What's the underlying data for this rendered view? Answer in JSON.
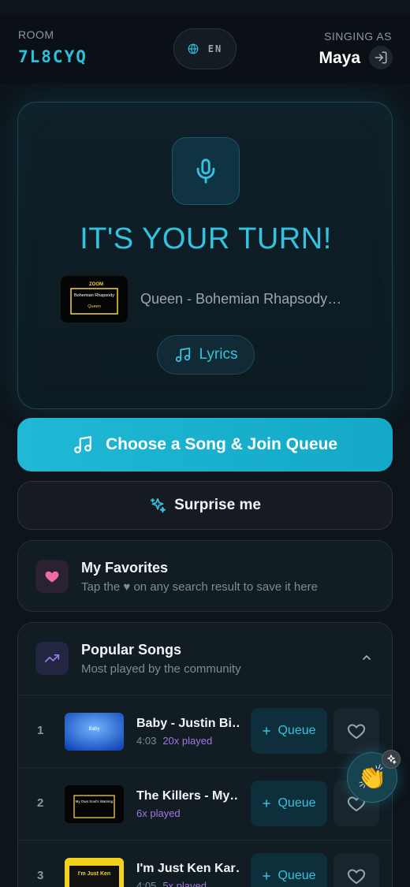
{
  "header": {
    "room_label": "ROOM",
    "room_code": "7L8CYQ",
    "language_code": "EN",
    "singing_label": "SINGING AS",
    "singer_name": "Maya"
  },
  "turn": {
    "title": "IT'S YOUR TURN!",
    "song": "Queen - Bohemian Rhapsody…",
    "thumb_title": "Bohemian Rhapsody",
    "thumb_artist": "Queen",
    "thumb_brand": "ZOOM",
    "lyrics_label": "Lyrics"
  },
  "actions": {
    "join_label": "Choose a Song & Join Queue",
    "surprise_label": "Surprise me"
  },
  "favorites": {
    "title": "My Favorites",
    "subtitle": "Tap the ♥ on any search result to save it here"
  },
  "popular": {
    "title": "Popular Songs",
    "subtitle": "Most played by the community",
    "queue_label": "Queue",
    "songs": [
      {
        "rank": "1",
        "title": "Baby - Justin Bi…",
        "duration": "4:03",
        "plays": "20x played",
        "thumb_text": "Baby"
      },
      {
        "rank": "2",
        "title": "The Killers - My…",
        "duration": "",
        "plays": "6x played",
        "thumb_text": "My Own Soul's Warning"
      },
      {
        "rank": "3",
        "title": "I'm Just Ken Kar…",
        "duration": "4:05",
        "plays": "5x played",
        "thumb_text": "I'm Just Ken"
      }
    ]
  },
  "colors": {
    "accent": "#2cc0de",
    "background": "#0d141a",
    "plays": "#a178e0",
    "favorite": "#f06aa8"
  },
  "icons": [
    "globe-icon",
    "logout-icon",
    "microphone-icon",
    "music-note-icon",
    "sparkles-icon",
    "heart-icon",
    "trending-up-icon",
    "chevron-up-icon",
    "plus-icon",
    "applause-icon"
  ]
}
